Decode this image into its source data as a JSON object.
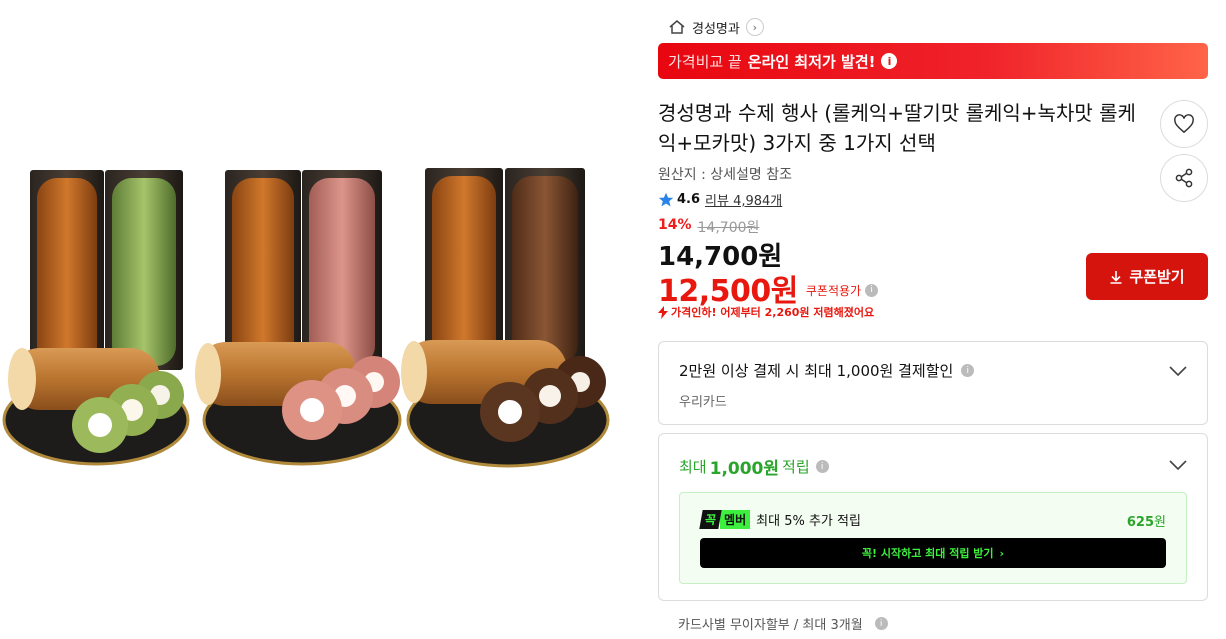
{
  "breadcrumb": {
    "store": "경성명과"
  },
  "banner": {
    "prefix": "가격비교 끝",
    "highlight": "온라인 최저가 발견!",
    "info_icon": "info-icon"
  },
  "product": {
    "title": "경성명과 수제 행사 (롤케익+딸기맛 롤케익+녹차맛 롤케익+모카맛) 3가지 중 1가지 선택",
    "origin": "원산지 : 상세설명 참조",
    "rating": "4.6",
    "review_label": "리뷰 4,984개",
    "discount_rate": "14%",
    "original_price": "14,700원",
    "price": "14,700원",
    "coupon_price": "12,500원",
    "coupon_applied_label": "쿠폰적용가",
    "price_drop_text": "가격인하! 어제부터 2,260원 저렴해졌어요"
  },
  "actions": {
    "coupon_button": "쿠폰받기"
  },
  "card_discount": {
    "title": "2만원 이상 결제 시 최대 1,000원 결제할인",
    "card_name": "우리카드"
  },
  "reward": {
    "prefix": "최대",
    "amount": "1,000원",
    "suffix": "적립",
    "member_badge_k": "꼭",
    "member_badge_m": "멤버",
    "member_text": "최대 5% 추가 적립",
    "member_points": "625",
    "member_points_unit": "원",
    "member_cta": "꼭! 시작하고 최대 적립 받기"
  },
  "installment": {
    "text": "카드사별 무이자할부 / 최대 3개월"
  },
  "colors": {
    "accent_red": "#e8180f",
    "reward_green": "#2ba42b",
    "member_green": "#3ef03e"
  }
}
